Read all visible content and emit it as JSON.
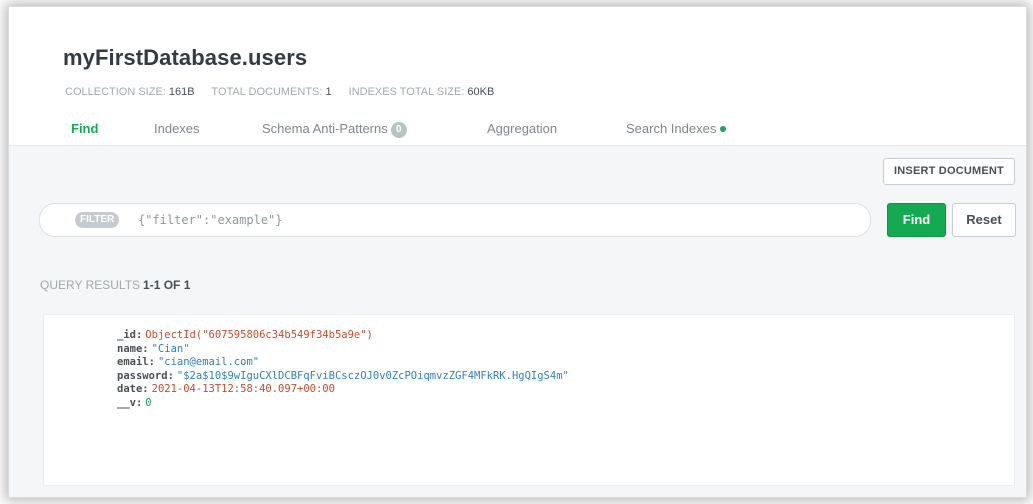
{
  "header": {
    "title": "myFirstDatabase.users",
    "stats": {
      "collection_size_label": "Collection size:",
      "collection_size_value": "161B",
      "total_documents_label": "Total documents:",
      "total_documents_value": "1",
      "indexes_size_label": "Indexes total size:",
      "indexes_size_value": "60KB"
    },
    "tabs": [
      {
        "label": "Find",
        "active": true
      },
      {
        "label": "Indexes",
        "active": false
      },
      {
        "label": "Schema Anti-Patterns",
        "active": false,
        "badge": "0"
      },
      {
        "label": "Aggregation",
        "active": false
      },
      {
        "label": "Search Indexes",
        "active": false,
        "status_dot": true
      }
    ]
  },
  "toolbar": {
    "insert_label": "Insert Document",
    "filter_badge": "FILTER",
    "filter_placeholder": "{\"filter\":\"example\"}",
    "find_label": "Find",
    "reset_label": "Reset"
  },
  "results": {
    "label": "Query results",
    "range": "1-1 OF 1"
  },
  "document": {
    "fields": [
      {
        "key": "_id",
        "value": "ObjectId(\"607595806c34b549f34b5a9e\")",
        "type": "oid"
      },
      {
        "key": "name",
        "value": "\"Cian\"",
        "type": "str"
      },
      {
        "key": "email",
        "value": "\"cian@email.com\"",
        "type": "str"
      },
      {
        "key": "password",
        "value": "\"$2a$10$9wIguCXlDCBFqFviBCsczOJ0v0ZcPOiqmvzZGF4MFkRK.HgQIgS4m\"",
        "type": "str"
      },
      {
        "key": "date",
        "value": "2021-04-13T12:58:40.097+00:00",
        "type": "date"
      },
      {
        "key": "__v",
        "value": "0",
        "type": "num"
      }
    ]
  },
  "colors": {
    "accent_green": "#13aa52",
    "objectid_red": "#c94b2f",
    "string_blue": "#2e7fc0"
  }
}
